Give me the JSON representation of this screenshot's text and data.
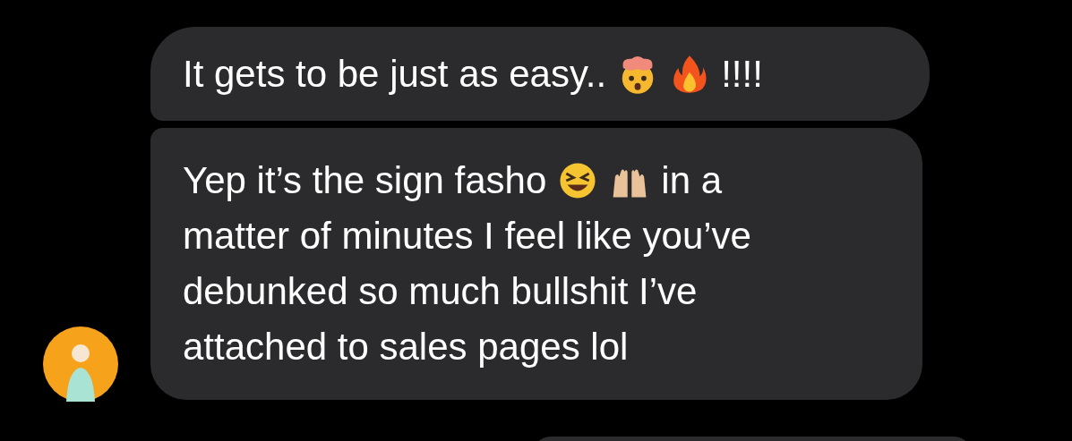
{
  "messages": [
    {
      "lines": [
        [
          {
            "kind": "text",
            "text": "It gets to be just as easy.."
          },
          {
            "kind": "emoji"
          },
          {
            "kind": "emoji"
          },
          {
            "kind": "text",
            "text": "!!!!"
          }
        ]
      ]
    },
    {
      "lines": [
        [
          {
            "kind": "text",
            "text": "Yep it’s the sign fasho"
          },
          {
            "kind": "emoji"
          },
          {
            "kind": "emoji"
          },
          {
            "kind": "text",
            "text": "in a"
          }
        ],
        [
          {
            "kind": "text",
            "text": "matter of minutes I feel like you’ve"
          }
        ],
        [
          {
            "kind": "text",
            "text": "debunked so much bullshit I’ve"
          }
        ],
        [
          {
            "kind": "text",
            "text": "attached to sales pages lol"
          }
        ]
      ],
      "avatar": true
    }
  ]
}
